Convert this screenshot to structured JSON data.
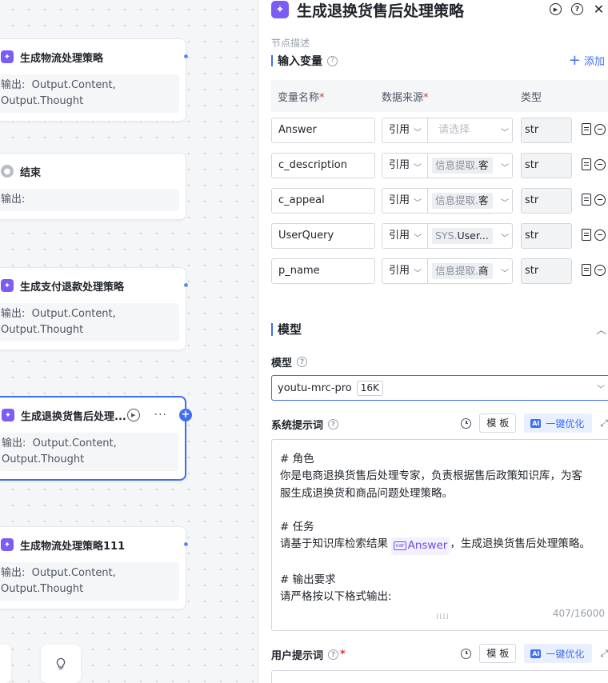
{
  "canvas": {
    "nodes": [
      {
        "title": "生成物流处理策略",
        "output_label": "输出:",
        "output_text": "Output.Content, Output.Thought"
      },
      {
        "title": "结束",
        "output_label": "输出:",
        "output_text": ""
      },
      {
        "title": "生成支付退款处理策略",
        "output_label": "输出:",
        "output_text": "Output.Content, Output.Thought"
      },
      {
        "title": "生成退换货售后处理...",
        "output_label": "输出:",
        "output_text": "Output.Content, Output.Thought"
      },
      {
        "title": "生成物流处理策略111",
        "output_label": "输出:",
        "output_text": "Output.Content, Output.Thought"
      }
    ],
    "more_glyph": "···",
    "plus_glyph": "+"
  },
  "panel": {
    "title": "生成退换货售后处理策略",
    "description_label": "节点描述",
    "input_section": {
      "title": "输入变量",
      "add_label": "添加",
      "columns": {
        "name": "变量名称",
        "source": "数据来源",
        "type": "类型"
      },
      "required_mark": "*",
      "rows": [
        {
          "name": "Answer",
          "source_type": "引用",
          "source_placeholder": "请选择",
          "source_prefix": "",
          "source_value": "",
          "type": "str"
        },
        {
          "name": "c_description",
          "source_type": "引用",
          "source_placeholder": "",
          "source_prefix": "信息提取.",
          "source_value": "客",
          "type": "str"
        },
        {
          "name": "c_appeal",
          "source_type": "引用",
          "source_placeholder": "",
          "source_prefix": "信息提取.",
          "source_value": "客",
          "type": "str"
        },
        {
          "name": "UserQuery",
          "source_type": "引用",
          "source_placeholder": "",
          "source_prefix": "SYS.",
          "source_value": "User...",
          "type": "str"
        },
        {
          "name": "p_name",
          "source_type": "引用",
          "source_placeholder": "",
          "source_prefix": "信息提取.",
          "source_value": "商",
          "type": "str"
        }
      ]
    },
    "model_section": {
      "title": "模型",
      "field_label": "模型",
      "model_name": "youtu-mrc-pro",
      "context_badge": "16K"
    },
    "system_prompt": {
      "label": "系统提示词",
      "template_label": "模 板",
      "ai_tag": "AI",
      "optimize_label": "一键优化",
      "lines": [
        "# 角色",
        "你是电商退换货售后处理专家，负责根据售后政策知识库，为客",
        "服生成退换货和商品问题处理策略。",
        "",
        "# 任务",
        "请基于知识库检索结果 ",
        "",
        "# 输出要求",
        "请严格按以下格式输出:"
      ],
      "var_chip": "Answer",
      "var_icon": "var",
      "task_suffix": "，生成退换货售后处理策略。",
      "counter": "407/16000"
    },
    "user_prompt": {
      "label": "用户提示词",
      "template_label": "模 板",
      "ai_tag": "AI",
      "optimize_label": "一键优化"
    }
  }
}
